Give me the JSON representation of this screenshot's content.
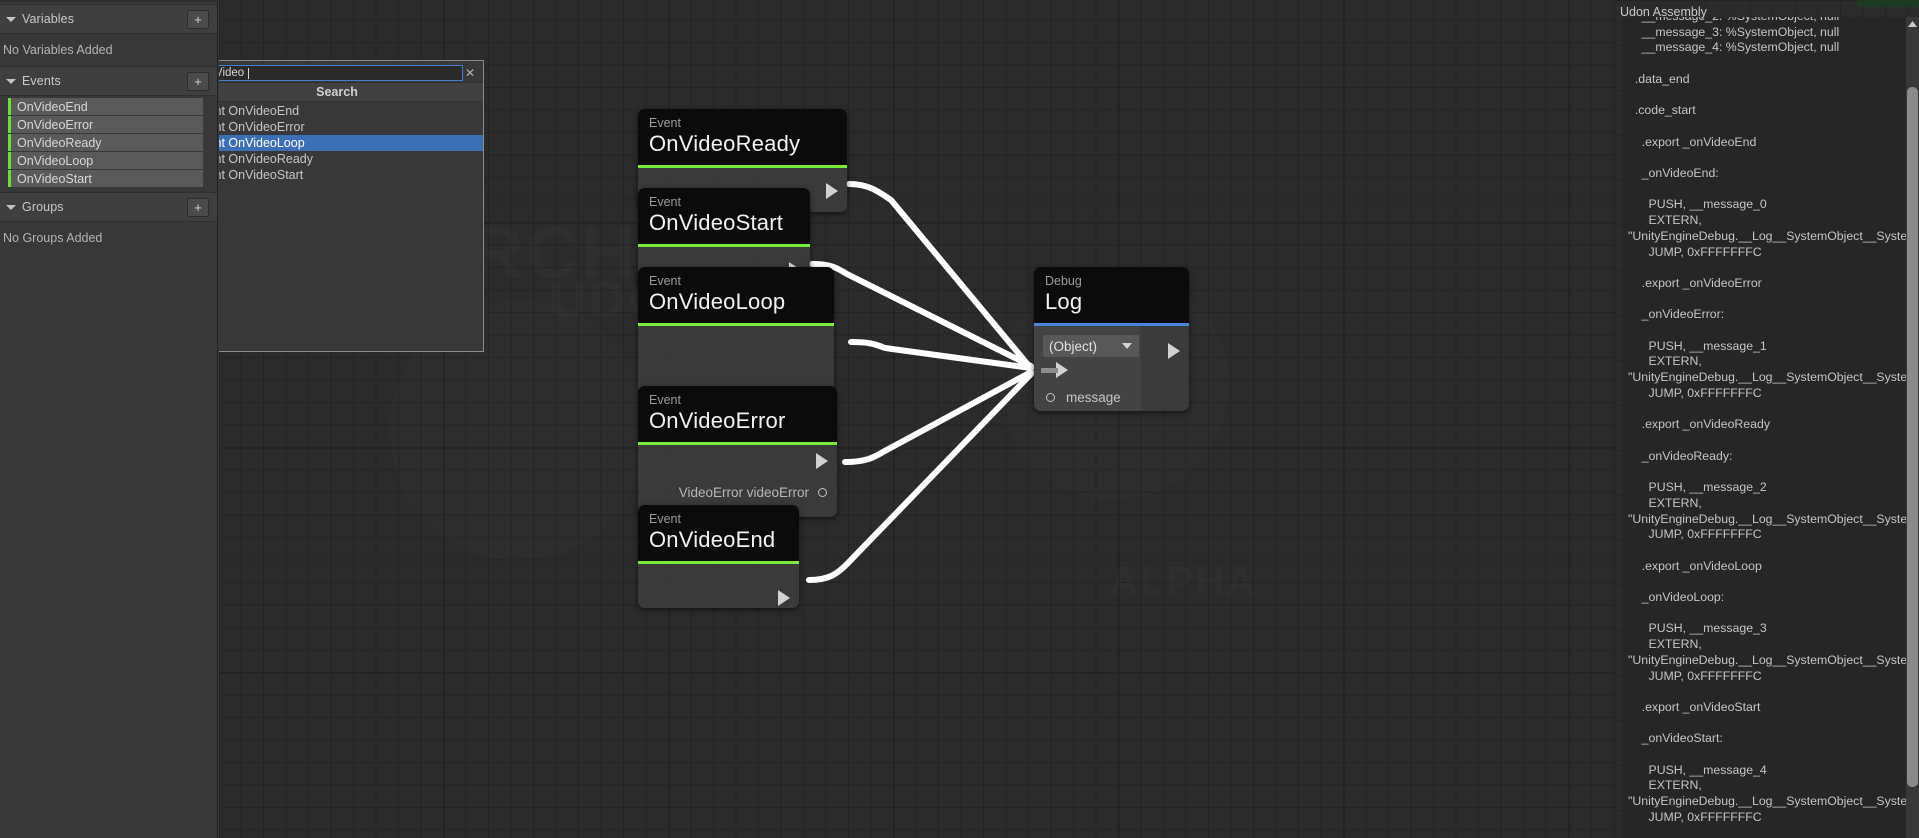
{
  "sidebar": {
    "sections": [
      {
        "title": "Variables",
        "empty_text": "No Variables Added",
        "add_label": "+"
      },
      {
        "title": "Events",
        "add_label": "+"
      },
      {
        "title": "Groups",
        "empty_text": "No Groups Added",
        "add_label": "+"
      }
    ],
    "events": [
      {
        "label": "OnVideoEnd"
      },
      {
        "label": "OnVideoError"
      },
      {
        "label": "OnVideoReady"
      },
      {
        "label": "OnVideoLoop"
      },
      {
        "label": "OnVideoStart"
      }
    ],
    "accent_color": "#68e23a"
  },
  "search_popup": {
    "query": "Video",
    "placeholder": "Search",
    "clear_label": "✕",
    "header": "Search",
    "results": [
      {
        "label": "Event OnVideoEnd",
        "selected": false
      },
      {
        "label": "Event OnVideoError",
        "selected": false
      },
      {
        "label": "Event OnVideoLoop",
        "selected": true
      },
      {
        "label": "Event OnVideoReady",
        "selected": false
      },
      {
        "label": "Event OnVideoStart",
        "selected": false
      }
    ],
    "selected_color": "#3d6fb5"
  },
  "graph": {
    "watermark": {
      "line1": "VRCHAT",
      "line2": "UDON",
      "line3": "ALPHA"
    },
    "event_accent": "#76ed3c",
    "node_accent_debug": "#4a86d8",
    "nodes": [
      {
        "subtitle": "Event",
        "title": "OnVideoReady"
      },
      {
        "subtitle": "Event",
        "title": "OnVideoStart"
      },
      {
        "subtitle": "Event",
        "title": "OnVideoLoop"
      },
      {
        "subtitle": "Event",
        "title": "OnVideoError",
        "param": "VideoError videoError"
      },
      {
        "subtitle": "Event",
        "title": "OnVideoEnd"
      }
    ],
    "debug_node": {
      "subtitle": "Debug",
      "title": "Log",
      "dropdown_value": "(Object)",
      "input_label": "message"
    }
  },
  "right_panel": {
    "title": "Udon Assembly",
    "code": "    __message_2: %SystemObject, null\n    __message_3: %SystemObject, null\n    __message_4: %SystemObject, null\n\n  .data_end\n\n  .code_start\n\n    .export _onVideoEnd\n\n    _onVideoEnd:\n\n      PUSH, __message_0\n      EXTERN,\n\"UnityEngineDebug.__Log__SystemObject__SystemVoid\"\n      JUMP, 0xFFFFFFFC\n\n    .export _onVideoError\n\n    _onVideoError:\n\n      PUSH, __message_1\n      EXTERN,\n\"UnityEngineDebug.__Log__SystemObject__SystemVoid\"\n      JUMP, 0xFFFFFFFC\n\n    .export _onVideoReady\n\n    _onVideoReady:\n\n      PUSH, __message_2\n      EXTERN,\n\"UnityEngineDebug.__Log__SystemObject__SystemVoid\"\n      JUMP, 0xFFFFFFFC\n\n    .export _onVideoLoop\n\n    _onVideoLoop:\n\n      PUSH, __message_3\n      EXTERN,\n\"UnityEngineDebug.__Log__SystemObject__SystemVoid\"\n      JUMP, 0xFFFFFFFC\n\n    .export _onVideoStart\n\n    _onVideoStart:\n\n      PUSH, __message_4\n      EXTERN,\n\"UnityEngineDebug.__Log__SystemObject__SystemVoid\"\n      JUMP, 0xFFFFFFFC"
  }
}
